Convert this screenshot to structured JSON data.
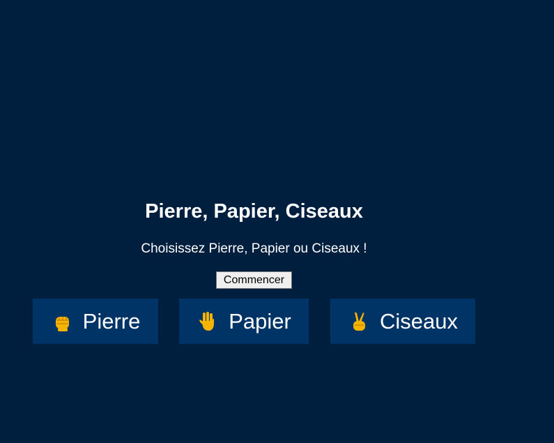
{
  "game": {
    "title": "Pierre, Papier, Ciseaux",
    "instruction": "Choisissez Pierre, Papier ou Ciseaux !",
    "start_label": "Commencer"
  },
  "choices": [
    {
      "id": "rock",
      "label": "Pierre",
      "icon": "raised-fist-icon"
    },
    {
      "id": "paper",
      "label": "Papier",
      "icon": "raised-hand-icon"
    },
    {
      "id": "scissors",
      "label": "Ciseaux",
      "icon": "victory-hand-icon"
    }
  ],
  "colors": {
    "background": "#001f3f",
    "button": "#003366",
    "text": "#ffffff",
    "emoji": "#f4b400"
  }
}
